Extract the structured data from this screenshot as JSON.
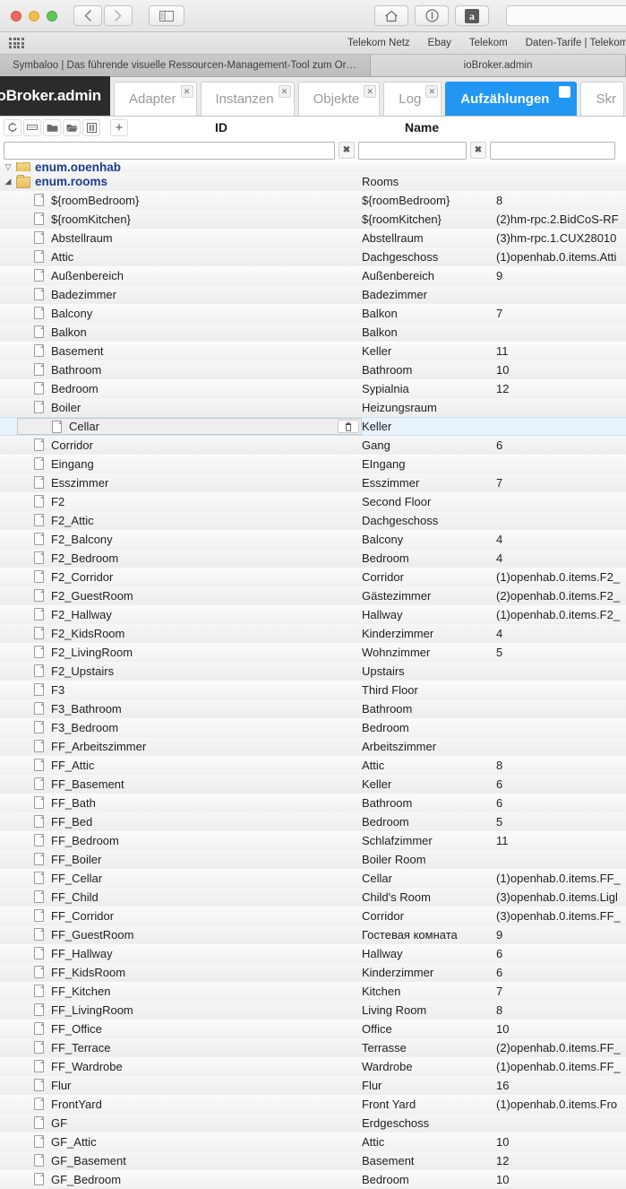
{
  "browser": {
    "nav": {
      "back": "‹",
      "forward": "›"
    },
    "icons": {
      "sidebar": "sidebar-icon",
      "home": "home-icon",
      "shield": "shield-icon",
      "amazon": "a"
    },
    "bookmarks": [
      "Telekom Netz",
      "Ebay",
      "Telekom",
      "Daten-Tarife | Telekom"
    ],
    "tabs": [
      {
        "title": "Symbaloo | Das führende visuelle Ressourcen-Management-Tool zum Or…",
        "active": false
      },
      {
        "title": "ioBroker.admin",
        "active": true
      }
    ]
  },
  "app": {
    "brand": "ioBroker.admin",
    "tabs": [
      {
        "label": "Adapter",
        "selected": false,
        "close": "✕"
      },
      {
        "label": "Instanzen",
        "selected": false,
        "close": "✕"
      },
      {
        "label": "Objekte",
        "selected": false,
        "close": "✕"
      },
      {
        "label": "Log",
        "selected": false,
        "close": "✕"
      },
      {
        "label": "Aufzählungen",
        "selected": true,
        "close": "✕"
      },
      {
        "label": "Skr",
        "selected": false,
        "close": ""
      }
    ],
    "toolbar": {
      "buttons": [
        {
          "name": "refresh-icon",
          "glyph": "⟳"
        },
        {
          "name": "list-icon",
          "glyph": "▤"
        },
        {
          "name": "folder-closed-icon",
          "glyph": "▰"
        },
        {
          "name": "folder-open-icon",
          "glyph": "▱"
        },
        {
          "name": "columns-icon",
          "glyph": "◫"
        }
      ],
      "add_label": "+"
    },
    "columns": {
      "id": "ID",
      "name": "Name"
    },
    "filters": {
      "id_value": "",
      "id_placeholder": "",
      "name_value": "",
      "name_placeholder": "",
      "value_value": "",
      "value_placeholder": "",
      "clear_glyph": "✖"
    },
    "accent_color": "#2196f3",
    "selected_row_color": "#e8f3fb"
  },
  "table": {
    "rows": [
      {
        "type": "group",
        "indent": 0,
        "twisty": "▽",
        "id": "enum.openhab",
        "name": "",
        "value": "",
        "clipped": true
      },
      {
        "type": "group",
        "indent": 0,
        "twisty": "◢",
        "id": "enum.rooms",
        "name": "Rooms",
        "value": ""
      },
      {
        "type": "leaf",
        "indent": 1,
        "id": "${roomBedroom}",
        "name": "${roomBedroom}",
        "value": "8"
      },
      {
        "type": "leaf",
        "indent": 1,
        "id": "${roomKitchen}",
        "name": "${roomKitchen}",
        "value": "(2)hm-rpc.2.BidCoS-RF"
      },
      {
        "type": "leaf",
        "indent": 1,
        "id": "Abstellraum",
        "name": "Abstellraum",
        "value": "(3)hm-rpc.1.CUX28010"
      },
      {
        "type": "leaf",
        "indent": 1,
        "id": "Attic",
        "name": "Dachgeschoss",
        "value": "(1)openhab.0.items.Atti"
      },
      {
        "type": "leaf",
        "indent": 1,
        "id": "Außenbereich",
        "name": "Außenbereich",
        "value": "9"
      },
      {
        "type": "leaf",
        "indent": 1,
        "id": "Badezimmer",
        "name": "Badezimmer",
        "value": ""
      },
      {
        "type": "leaf",
        "indent": 1,
        "id": "Balcony",
        "name": "Balkon",
        "value": "7"
      },
      {
        "type": "leaf",
        "indent": 1,
        "id": "Balkon",
        "name": "Balkon",
        "value": ""
      },
      {
        "type": "leaf",
        "indent": 1,
        "id": "Basement",
        "name": "Keller",
        "value": "11"
      },
      {
        "type": "leaf",
        "indent": 1,
        "id": "Bathroom",
        "name": "Bathroom",
        "value": "10"
      },
      {
        "type": "leaf",
        "indent": 1,
        "id": "Bedroom",
        "name": "Sypialnia",
        "value": "12"
      },
      {
        "type": "leaf",
        "indent": 1,
        "id": "Boiler",
        "name": "Heizungsraum",
        "value": ""
      },
      {
        "type": "leaf",
        "indent": 1,
        "id": "Cellar",
        "name": "Keller",
        "value": "",
        "selected": true,
        "trash": "🗑"
      },
      {
        "type": "leaf",
        "indent": 1,
        "id": "Corridor",
        "name": "Gang",
        "value": "6"
      },
      {
        "type": "leaf",
        "indent": 1,
        "id": "Eingang",
        "name": "EIngang",
        "value": ""
      },
      {
        "type": "leaf",
        "indent": 1,
        "id": "Esszimmer",
        "name": "Esszimmer",
        "value": "7"
      },
      {
        "type": "leaf",
        "indent": 1,
        "id": "F2",
        "name": "Second Floor",
        "value": ""
      },
      {
        "type": "leaf",
        "indent": 1,
        "id": "F2_Attic",
        "name": "Dachgeschoss",
        "value": ""
      },
      {
        "type": "leaf",
        "indent": 1,
        "id": "F2_Balcony",
        "name": "Balcony",
        "value": "4"
      },
      {
        "type": "leaf",
        "indent": 1,
        "id": "F2_Bedroom",
        "name": "Bedroom",
        "value": "4"
      },
      {
        "type": "leaf",
        "indent": 1,
        "id": "F2_Corridor",
        "name": "Corridor",
        "value": "(1)openhab.0.items.F2_"
      },
      {
        "type": "leaf",
        "indent": 1,
        "id": "F2_GuestRoom",
        "name": "Gästezimmer",
        "value": "(2)openhab.0.items.F2_"
      },
      {
        "type": "leaf",
        "indent": 1,
        "id": "F2_Hallway",
        "name": "Hallway",
        "value": "(1)openhab.0.items.F2_"
      },
      {
        "type": "leaf",
        "indent": 1,
        "id": "F2_KidsRoom",
        "name": "Kinderzimmer",
        "value": "4"
      },
      {
        "type": "leaf",
        "indent": 1,
        "id": "F2_LivingRoom",
        "name": "Wohnzimmer",
        "value": "5"
      },
      {
        "type": "leaf",
        "indent": 1,
        "id": "F2_Upstairs",
        "name": "Upstairs",
        "value": ""
      },
      {
        "type": "leaf",
        "indent": 1,
        "id": "F3",
        "name": "Third Floor",
        "value": ""
      },
      {
        "type": "leaf",
        "indent": 1,
        "id": "F3_Bathroom",
        "name": "Bathroom",
        "value": ""
      },
      {
        "type": "leaf",
        "indent": 1,
        "id": "F3_Bedroom",
        "name": "Bedroom",
        "value": ""
      },
      {
        "type": "leaf",
        "indent": 1,
        "id": "FF_Arbeitszimmer",
        "name": "Arbeitszimmer",
        "value": ""
      },
      {
        "type": "leaf",
        "indent": 1,
        "id": "FF_Attic",
        "name": "Attic",
        "value": "8"
      },
      {
        "type": "leaf",
        "indent": 1,
        "id": "FF_Basement",
        "name": "Keller",
        "value": "6"
      },
      {
        "type": "leaf",
        "indent": 1,
        "id": "FF_Bath",
        "name": "Bathroom",
        "value": "6"
      },
      {
        "type": "leaf",
        "indent": 1,
        "id": "FF_Bed",
        "name": "Bedroom",
        "value": "5"
      },
      {
        "type": "leaf",
        "indent": 1,
        "id": "FF_Bedroom",
        "name": "Schlafzimmer",
        "value": "11"
      },
      {
        "type": "leaf",
        "indent": 1,
        "id": "FF_Boiler",
        "name": "Boiler Room",
        "value": ""
      },
      {
        "type": "leaf",
        "indent": 1,
        "id": "FF_Cellar",
        "name": "Cellar",
        "value": "(1)openhab.0.items.FF_"
      },
      {
        "type": "leaf",
        "indent": 1,
        "id": "FF_Child",
        "name": "Child's Room",
        "value": "(3)openhab.0.items.Ligl"
      },
      {
        "type": "leaf",
        "indent": 1,
        "id": "FF_Corridor",
        "name": "Corridor",
        "value": "(3)openhab.0.items.FF_"
      },
      {
        "type": "leaf",
        "indent": 1,
        "id": "FF_GuestRoom",
        "name": "Гостевая комната",
        "value": "9"
      },
      {
        "type": "leaf",
        "indent": 1,
        "id": "FF_Hallway",
        "name": "Hallway",
        "value": "6"
      },
      {
        "type": "leaf",
        "indent": 1,
        "id": "FF_KidsRoom",
        "name": "Kinderzimmer",
        "value": "6"
      },
      {
        "type": "leaf",
        "indent": 1,
        "id": "FF_Kitchen",
        "name": "Kitchen",
        "value": "7"
      },
      {
        "type": "leaf",
        "indent": 1,
        "id": "FF_LivingRoom",
        "name": "Living Room",
        "value": "8"
      },
      {
        "type": "leaf",
        "indent": 1,
        "id": "FF_Office",
        "name": "Office",
        "value": "10"
      },
      {
        "type": "leaf",
        "indent": 1,
        "id": "FF_Terrace",
        "name": "Terrasse",
        "value": "(2)openhab.0.items.FF_"
      },
      {
        "type": "leaf",
        "indent": 1,
        "id": "FF_Wardrobe",
        "name": "Wardrobe",
        "value": "(1)openhab.0.items.FF_"
      },
      {
        "type": "leaf",
        "indent": 1,
        "id": "Flur",
        "name": "Flur",
        "value": "16"
      },
      {
        "type": "leaf",
        "indent": 1,
        "id": "FrontYard",
        "name": "Front Yard",
        "value": "(1)openhab.0.items.Fro"
      },
      {
        "type": "leaf",
        "indent": 1,
        "id": "GF",
        "name": "Erdgeschoss",
        "value": ""
      },
      {
        "type": "leaf",
        "indent": 1,
        "id": "GF_Attic",
        "name": "Attic",
        "value": "10"
      },
      {
        "type": "leaf",
        "indent": 1,
        "id": "GF_Basement",
        "name": "Basement",
        "value": "12"
      },
      {
        "type": "leaf",
        "indent": 1,
        "id": "GF_Bedroom",
        "name": "Bedroom",
        "value": "10"
      }
    ]
  }
}
